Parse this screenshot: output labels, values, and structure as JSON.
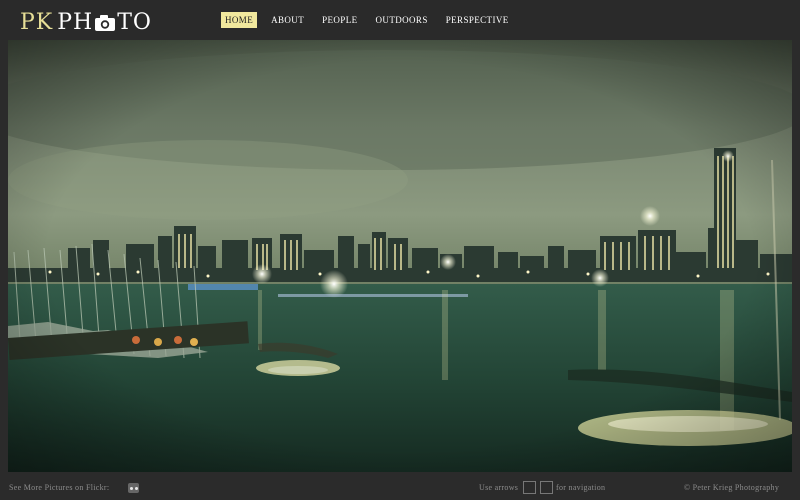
{
  "logo": {
    "monogram": "PK",
    "word_before": "PH",
    "word_after": "TO",
    "camera_icon": "camera-icon"
  },
  "nav": {
    "items": [
      {
        "label": "HOME",
        "active": true
      },
      {
        "label": "ABOUT",
        "active": false
      },
      {
        "label": "PEOPLE",
        "active": false
      },
      {
        "label": "OUTDOORS",
        "active": false
      },
      {
        "label": "PERSPECTIVE",
        "active": false
      }
    ]
  },
  "slideshow": {
    "photo_subject": "night-city-skyline-over-river-with-sailboats",
    "current_slide": 1,
    "slide_count": 5
  },
  "footer": {
    "flickr_text": "See More Pictures on Flickr:",
    "flickr_icon": "flickr-icon",
    "arrows_text": "Use arrows",
    "navigation_text": "for navigation",
    "copyright": "© Peter Krieg Photography"
  },
  "colors": {
    "accent": "#f1e89d",
    "background": "#2b2b2b",
    "footer_text": "#8c8c8c",
    "sky": "#77836d",
    "water": "#26483b"
  }
}
